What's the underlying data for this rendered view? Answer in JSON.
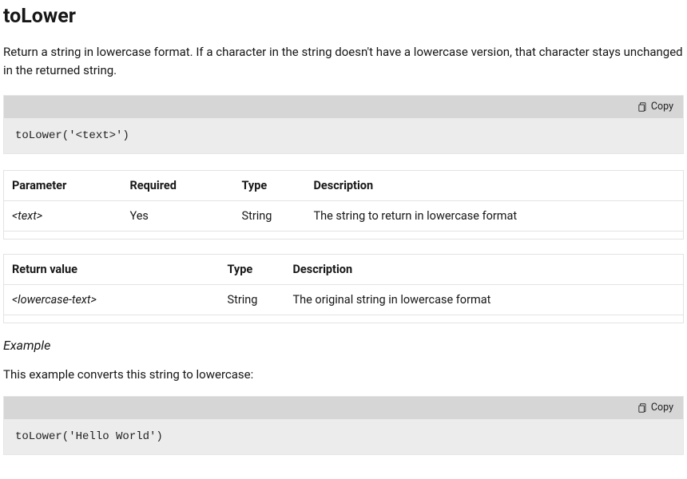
{
  "title": "toLower",
  "description": "Return a string in lowercase format. If a character in the string doesn't have a lowercase version, that character stays unchanged in the returned string.",
  "copy_label": "Copy",
  "code_syntax": "toLower('<text>')",
  "params_table": {
    "headers": [
      "Parameter",
      "Required",
      "Type",
      "Description"
    ],
    "rows": [
      {
        "name": "<text>",
        "required": "Yes",
        "type": "String",
        "desc": "The string to return in lowercase format"
      }
    ]
  },
  "return_table": {
    "headers": [
      "Return value",
      "Type",
      "Description"
    ],
    "rows": [
      {
        "name": "<lowercase-text>",
        "type": "String",
        "desc": "The original string in lowercase format"
      }
    ]
  },
  "example_heading": "Example",
  "example_intro": "This example converts this string to lowercase:",
  "code_example": "toLower('Hello World')"
}
